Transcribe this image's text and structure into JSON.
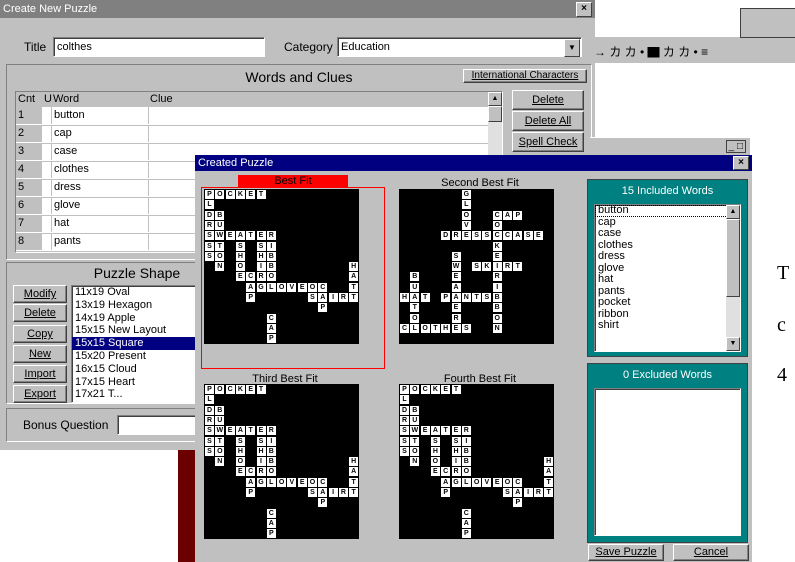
{
  "background_text": {
    "line1": "T",
    "line2": "c",
    "line3": "4"
  },
  "toolbar_fragment": "→ カ カ • ▇ カ カ • ≡",
  "create_window": {
    "title": "Create New Puzzle",
    "close_label": "×",
    "title_label": "Title",
    "title_value": "colthes",
    "category_label": "Category",
    "category_value": "Education",
    "words_header": "Words and Clues",
    "intl_button": "International Characters",
    "col_cnt": "Cnt",
    "col_u": "U",
    "col_word": "Word",
    "col_clue": "Clue",
    "rows": [
      {
        "n": "1",
        "word": "button"
      },
      {
        "n": "2",
        "word": "cap"
      },
      {
        "n": "3",
        "word": "case"
      },
      {
        "n": "4",
        "word": "clothes"
      },
      {
        "n": "5",
        "word": "dress"
      },
      {
        "n": "6",
        "word": "glove"
      },
      {
        "n": "7",
        "word": "hat"
      },
      {
        "n": "8",
        "word": "pants"
      }
    ],
    "delete_button": "Delete",
    "delete_all_button": "Delete All",
    "spell_check_button": "Spell Check",
    "shape_header": "Puzzle Shape",
    "modify_button": "Modify",
    "delete_shape_button": "Delete",
    "copy_button": "Copy",
    "new_button": "New",
    "import_button": "Import",
    "export_button": "Export",
    "shapes": [
      "11x19 Oval",
      "13x19 Hexagon",
      "14x19 Apple",
      "15x15 New Layout",
      "15x15 Square",
      "15x20 Present",
      "16x15 Cloud",
      "17x15 Heart",
      "17x21 T..."
    ],
    "selected_shape_index": 4,
    "bonus_label": "Bonus Question",
    "bonus_value": ""
  },
  "created_window": {
    "title": "Created Puzzle",
    "close_label": "×",
    "fits": [
      "Best Fit",
      "Second Best Fit",
      "Third Best Fit",
      "Fourth Best Fit"
    ],
    "included_header": "15 Included Words",
    "included_words": [
      "button",
      "cap",
      "case",
      "clothes",
      "dress",
      "glove",
      "hat",
      "pants",
      "pocket",
      "ribbon",
      "shirt"
    ],
    "excluded_header": "0 Excluded Words",
    "save_button": "Save Puzzle",
    "cancel_button": "Cancel",
    "back_window_controls": "_ □"
  },
  "colors": {
    "titlebar": "#808080",
    "active_titlebar": "#000080",
    "teal": "#008080",
    "best_fit_red": "#ff0000"
  }
}
